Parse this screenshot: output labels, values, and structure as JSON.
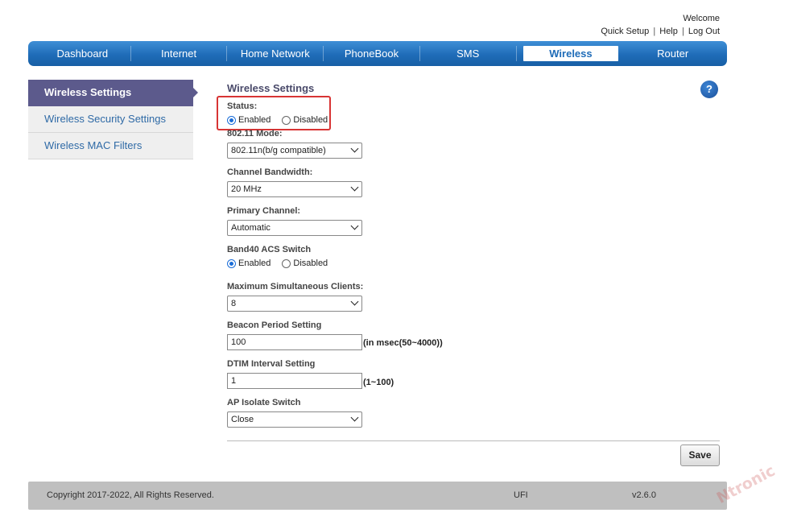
{
  "header": {
    "welcome": "Welcome",
    "links": [
      "Quick Setup",
      "Help",
      "Log Out"
    ],
    "separator": "|"
  },
  "nav": {
    "items": [
      "Dashboard",
      "Internet",
      "Home Network",
      "PhoneBook",
      "SMS",
      "Wireless",
      "Router"
    ],
    "active": "Wireless"
  },
  "sidebar": {
    "items": [
      "Wireless Settings",
      "Wireless Security Settings",
      "Wireless MAC Filters"
    ],
    "active": "Wireless Settings"
  },
  "main": {
    "title": "Wireless Settings",
    "help_icon": "?",
    "status": {
      "label": "Status:",
      "options": [
        "Enabled",
        "Disabled"
      ],
      "selected": "Enabled"
    },
    "mode": {
      "label": "802.11 Mode:",
      "value": "802.11n(b/g compatible)"
    },
    "bandwidth": {
      "label": "Channel Bandwidth:",
      "value": "20 MHz"
    },
    "primary_channel": {
      "label": "Primary Channel:",
      "value": "Automatic"
    },
    "band40": {
      "label": "Band40 ACS Switch",
      "options": [
        "Enabled",
        "Disabled"
      ],
      "selected": "Enabled"
    },
    "max_clients": {
      "label": "Maximum Simultaneous Clients:",
      "value": "8"
    },
    "beacon": {
      "label": "Beacon Period Setting",
      "value": "100",
      "unit": "(in msec(50~4000))"
    },
    "dtim": {
      "label": "DTIM Interval Setting",
      "value": "1",
      "unit": "(1~100)"
    },
    "ap_isolate": {
      "label": "AP Isolate Switch",
      "value": "Close"
    },
    "save_label": "Save"
  },
  "footer": {
    "copyright": "Copyright 2017-2022, All Rights Reserved.",
    "device": "UFI",
    "version": "v2.6.0"
  },
  "watermark": "Ntronic",
  "colors": {
    "nav_blue": "#1f6cb8",
    "sidebar_active": "#5c5a8c",
    "highlight_red": "#d83434"
  }
}
